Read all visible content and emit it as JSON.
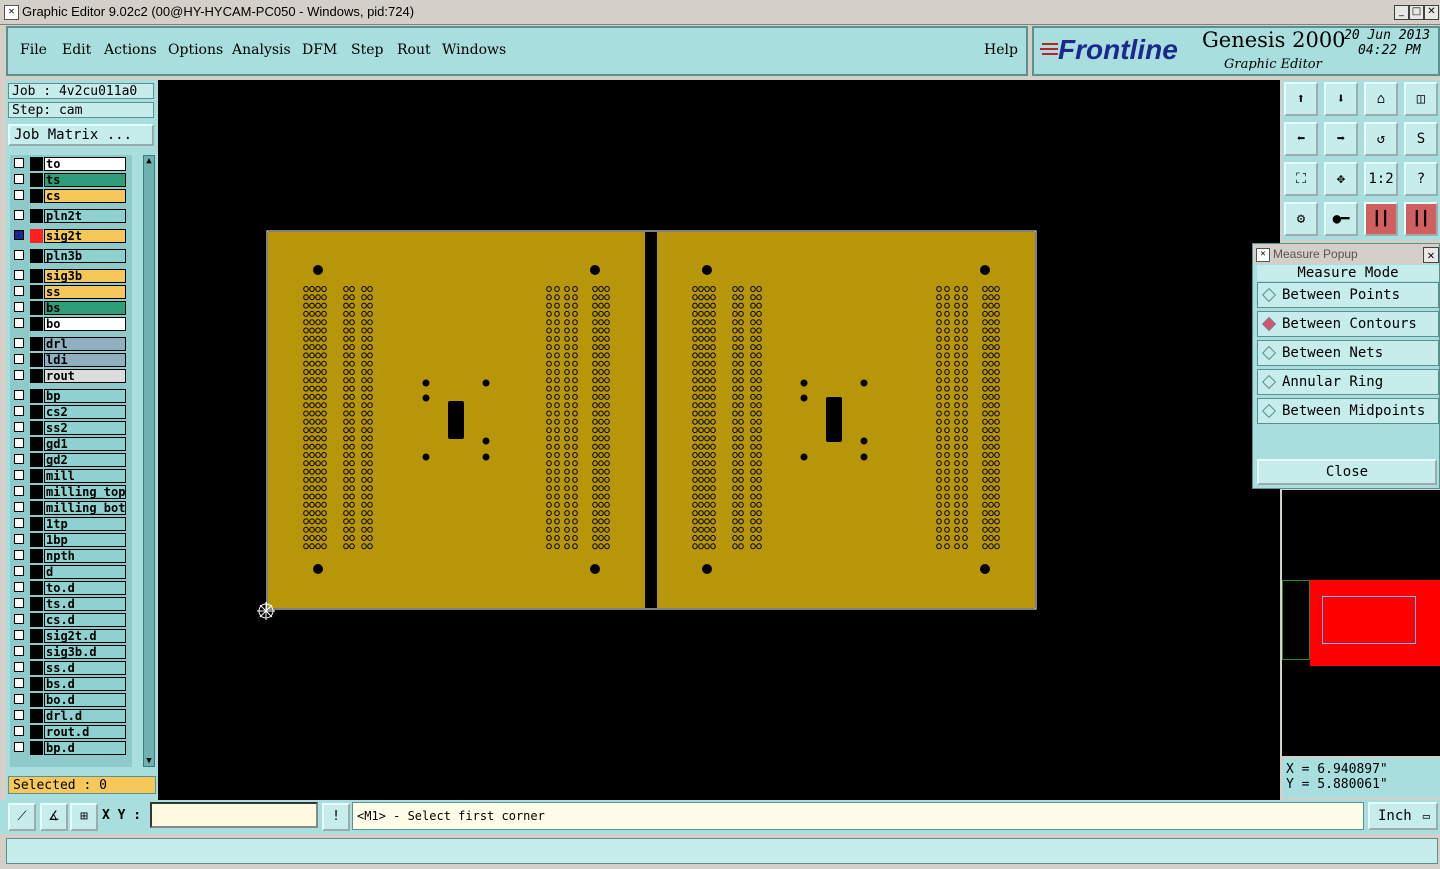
{
  "window": {
    "title": "Graphic Editor 9.02c2 (00@HY-HYCAM-PC050 - Windows, pid:724)"
  },
  "menu": {
    "items": [
      "File",
      "Edit",
      "Actions",
      "Options",
      "Analysis",
      "DFM",
      "Step",
      "Rout",
      "Windows"
    ],
    "help": "Help"
  },
  "brand": {
    "logo": "Frontline",
    "product": "Genesis 2000",
    "subtitle": "Graphic Editor",
    "date": "20 Jun 2013",
    "time": "04:22 PM"
  },
  "job": {
    "job": "Job : 4v2cu011a0",
    "step": "Step: cam",
    "matrix_button": "Job Matrix ..."
  },
  "layers": [
    {
      "name": "to",
      "color": "#ffffff"
    },
    {
      "name": "ts",
      "color": "#2e9e7a"
    },
    {
      "name": "cs",
      "color": "#f6c85a"
    },
    {
      "name": "pln2t",
      "color": "#8fd0d0"
    },
    {
      "name": "sig2t",
      "color": "#f6c85a",
      "active": true
    },
    {
      "name": "pln3b",
      "color": "#8fd0d0"
    },
    {
      "name": "sig3b",
      "color": "#f6c85a"
    },
    {
      "name": "ss",
      "color": "#f6c85a"
    },
    {
      "name": "bs",
      "color": "#2e9e7a"
    },
    {
      "name": "bo",
      "color": "#ffffff"
    },
    {
      "name": "drl",
      "color": "#8fb0c0"
    },
    {
      "name": "ldi",
      "color": "#8fb0c0"
    },
    {
      "name": "rout",
      "color": "#dcdcdc"
    },
    {
      "name": "bp",
      "color": "#8fd0d0"
    },
    {
      "name": "cs2",
      "color": "#8fd0d0"
    },
    {
      "name": "ss2",
      "color": "#8fd0d0"
    },
    {
      "name": "gd1",
      "color": "#8fd0d0"
    },
    {
      "name": "gd2",
      "color": "#8fd0d0"
    },
    {
      "name": "mill",
      "color": "#8fd0d0"
    },
    {
      "name": "milling_top",
      "color": "#8fd0d0"
    },
    {
      "name": "milling_bot",
      "color": "#8fd0d0"
    },
    {
      "name": "1tp",
      "color": "#8fd0d0"
    },
    {
      "name": "1bp",
      "color": "#8fd0d0"
    },
    {
      "name": "npth",
      "color": "#8fd0d0"
    },
    {
      "name": "d",
      "color": "#8fd0d0"
    },
    {
      "name": "to.d",
      "color": "#8fd0d0"
    },
    {
      "name": "ts.d",
      "color": "#8fd0d0"
    },
    {
      "name": "cs.d",
      "color": "#8fd0d0"
    },
    {
      "name": "sig2t.d",
      "color": "#8fd0d0"
    },
    {
      "name": "sig3b.d",
      "color": "#8fd0d0"
    },
    {
      "name": "ss.d",
      "color": "#8fd0d0"
    },
    {
      "name": "bs.d",
      "color": "#8fd0d0"
    },
    {
      "name": "bo.d",
      "color": "#8fd0d0"
    },
    {
      "name": "drl.d",
      "color": "#8fd0d0"
    },
    {
      "name": "rout.d",
      "color": "#8fd0d0"
    },
    {
      "name": "bp.d",
      "color": "#8fd0d0"
    }
  ],
  "selected": "Selected : 0",
  "measure_popup": {
    "title": "Measure Popup",
    "mode_label": "Measure Mode",
    "options": [
      {
        "label": "Between Points",
        "selected": false
      },
      {
        "label": "Between Contours",
        "selected": true
      },
      {
        "label": "Between Nets",
        "selected": false
      },
      {
        "label": "Annular Ring",
        "selected": false
      },
      {
        "label": "Between Midpoints",
        "selected": false
      }
    ],
    "close_label": "Close"
  },
  "coords": {
    "x": "X = 6.940897\"",
    "y": "Y = 5.880061\""
  },
  "bottom": {
    "xy_label": "X Y :",
    "xy_value": "",
    "prompt": "<M1> - Select first corner",
    "unit": "Inch"
  },
  "colors": {
    "panel": "#a8dede",
    "board": "#b8960a",
    "canvas": "#000000",
    "overview_red": "#ff0000"
  }
}
